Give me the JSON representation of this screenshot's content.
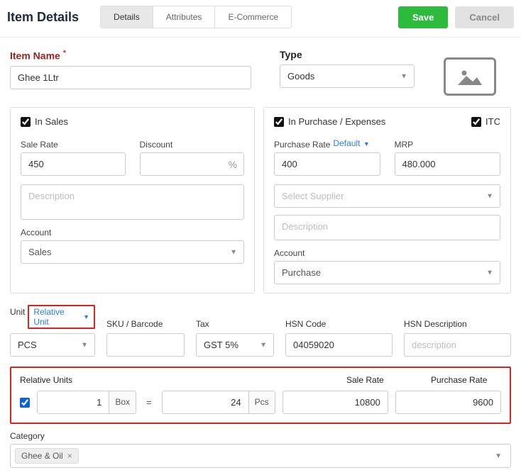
{
  "header": {
    "title": "Item Details",
    "tabs": [
      "Details",
      "Attributes",
      "E-Commerce"
    ],
    "save": "Save",
    "cancel": "Cancel"
  },
  "item": {
    "name_label": "Item Name",
    "name_value": "Ghee 1Ltr",
    "type_label": "Type",
    "type_value": "Goods"
  },
  "sales": {
    "in_sales": "In Sales",
    "sale_rate_label": "Sale Rate",
    "sale_rate_value": "450",
    "discount_label": "Discount",
    "discount_value": "",
    "description_placeholder": "Description",
    "account_label": "Account",
    "account_value": "Sales"
  },
  "purchase": {
    "in_purchase": "In Purchase / Expenses",
    "itc": "ITC",
    "purchase_rate_label": "Purchase Rate",
    "default_link": "Default",
    "purchase_rate_value": "400",
    "mrp_label": "MRP",
    "mrp_value": "480.000",
    "supplier_placeholder": "Select Supplier",
    "description_placeholder": "Description",
    "account_label": "Account",
    "account_value": "Purchase"
  },
  "bottom": {
    "unit_label": "Unit",
    "relative_unit": "Relative Unit",
    "unit_value": "PCS",
    "sku_label": "SKU / Barcode",
    "sku_value": "",
    "tax_label": "Tax",
    "tax_value": "GST 5%",
    "hsn_label": "HSN Code",
    "hsn_value": "04059020",
    "hsn_desc_label": "HSN Description",
    "hsn_desc_placeholder": "description"
  },
  "relative": {
    "title": "Relative Units",
    "sale_rate_label": "Sale Rate",
    "purchase_rate_label": "Purchase Rate",
    "qty1": "1",
    "unit1": "Box",
    "qty2": "24",
    "unit2": "Pcs",
    "sale_rate": "10800",
    "purchase_rate": "9600"
  },
  "category": {
    "label": "Category",
    "chip": "Ghee & Oil"
  }
}
